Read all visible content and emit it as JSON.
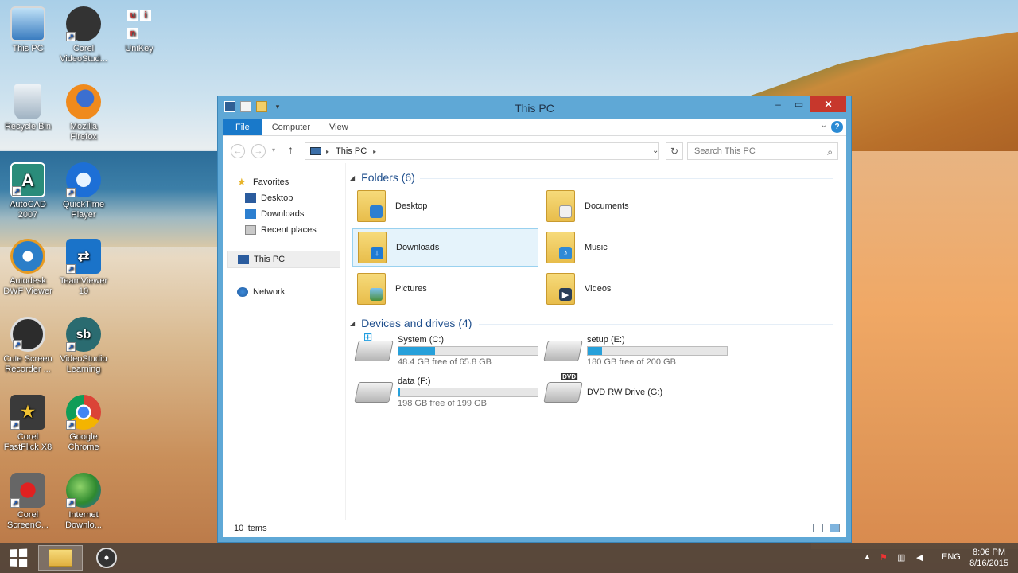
{
  "desktop": {
    "icons": [
      {
        "label": "This PC"
      },
      {
        "label": "Corel VideoStud..."
      },
      {
        "label": "UniKey"
      },
      {
        "label": "Recycle Bin"
      },
      {
        "label": "Mozilla Firefox"
      },
      {
        "label": "AutoCAD 2007"
      },
      {
        "label": "QuickTime Player"
      },
      {
        "label": "Autodesk DWF Viewer"
      },
      {
        "label": "TeamViewer 10"
      },
      {
        "label": "Cute Screen Recorder ..."
      },
      {
        "label": "VideoStudio Learning"
      },
      {
        "label": "Corel FastFlick X8"
      },
      {
        "label": "Google Chrome"
      },
      {
        "label": "Corel ScreenC..."
      },
      {
        "label": "Internet Downlo..."
      }
    ],
    "unikey_glyphs": {
      "u": "u",
      "n": "n",
      "i": "i"
    },
    "icon_glyphs": {
      "autocad": "A",
      "videostudio": "sb"
    }
  },
  "window": {
    "title": "This PC",
    "ribbon": {
      "tabs": [
        "File",
        "Computer",
        "View"
      ],
      "help": "?"
    },
    "address": {
      "crumb": "This PC",
      "search_placeholder": "Search This PC"
    },
    "nav": {
      "favorites": "Favorites",
      "favorites_items": [
        "Desktop",
        "Downloads",
        "Recent places"
      ],
      "this_pc": "This PC",
      "network": "Network"
    },
    "folders_header": "Folders (6)",
    "folders": [
      {
        "name": "Desktop",
        "icon": "folder-desktop-icon"
      },
      {
        "name": "Documents",
        "icon": "folder-documents-icon"
      },
      {
        "name": "Downloads",
        "icon": "folder-downloads-icon",
        "selected": true
      },
      {
        "name": "Music",
        "icon": "folder-music-icon"
      },
      {
        "name": "Pictures",
        "icon": "folder-pictures-icon"
      },
      {
        "name": "Videos",
        "icon": "folder-videos-icon"
      }
    ],
    "drives_header": "Devices and drives (4)",
    "drives": [
      {
        "name": "System (C:)",
        "free": "48.4 GB free of 65.8 GB",
        "used_fraction": 0.26
      },
      {
        "name": "setup (E:)",
        "free": "180 GB free of 200 GB",
        "used_fraction": 0.1
      },
      {
        "name": "data (F:)",
        "free": "198 GB free of 199 GB",
        "used_fraction": 0.01
      },
      {
        "name": "DVD RW Drive (G:)",
        "badge": "DVD"
      }
    ],
    "status": "10 items"
  },
  "taskbar": {
    "language": "ENG",
    "time": "8:06 PM",
    "date": "8/16/2015"
  },
  "colors": {
    "accent": "#1979ca",
    "progress": "#26a0da",
    "close": "#c7372c"
  }
}
